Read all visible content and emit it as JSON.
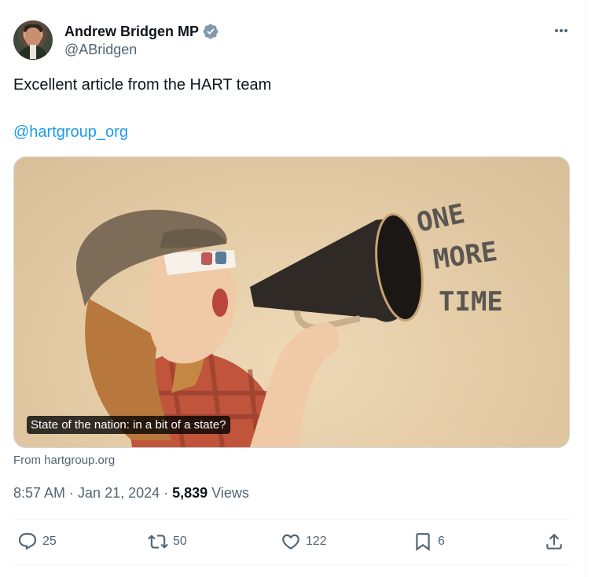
{
  "author": {
    "name": "Andrew Bridgen MP",
    "handle": "@ABridgen",
    "avatar_icon": "profile-photo",
    "verified_icon": "verified-badge-icon",
    "verified_color": "#829aab"
  },
  "tweet": {
    "text": "Excellent article from the HART team",
    "mention": "@hartgroup_org",
    "mention_color": "#1d9bf0"
  },
  "card": {
    "image_text": [
      "ONE",
      "MORE",
      "TIME"
    ],
    "caption": "State of the nation: in a bit of a state?",
    "source": "From hartgroup.org"
  },
  "meta": {
    "time": "8:57 AM",
    "separator": "·",
    "date": "Jan 21, 2024",
    "views_count": "5,839",
    "views_label": "Views"
  },
  "actions": {
    "replies": "25",
    "retweets": "50",
    "likes": "122",
    "bookmarks": "6"
  },
  "colors": {
    "primary_text": "#0f1419",
    "secondary_text": "#536471",
    "divider": "#eff3f4"
  }
}
